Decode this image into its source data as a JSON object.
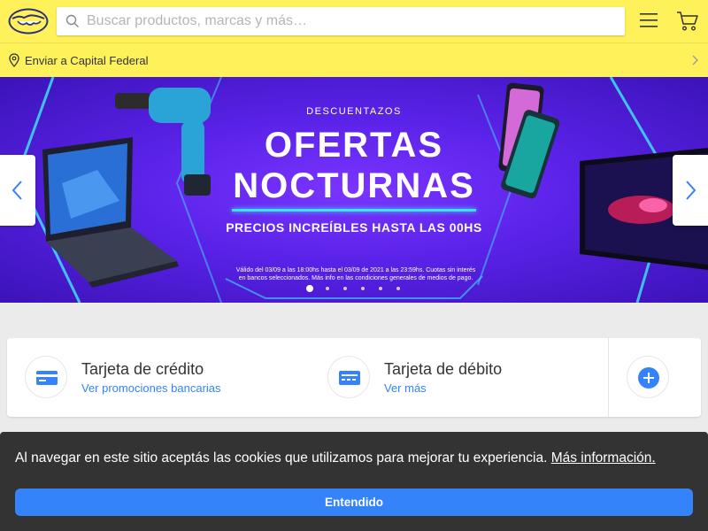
{
  "header": {
    "logo_name": "mercadolibre-handshake-logo",
    "search": {
      "placeholder": "Buscar productos, marcas y más…",
      "value": ""
    },
    "menu_icon": "hamburger-icon",
    "cart_icon": "cart-icon"
  },
  "shipping": {
    "label": "Enviar a Capital Federal",
    "icon": "location-pin-icon"
  },
  "banner": {
    "kicker": "DESCUENTAZOS",
    "title_line1": "OFERTAS",
    "title_line2": "NOCTURNAS",
    "subtitle": "PRECIOS INCREÍBLES HASTA LAS 00HS",
    "legal": "Válido del 03/09 a las 18:00hs hasta el 03/09 de 2021 a las 23:59hs. Cuotas sin interés en bancos seleccionados. Más info en las condiciones generales de medios de pago.",
    "slide_count": 6,
    "active_slide": 1,
    "colors": {
      "background": "#5a22e8",
      "neon": "#3de0ff"
    }
  },
  "payments": [
    {
      "title": "Tarjeta de crédito",
      "link": "Ver promociones bancarias",
      "icon": "credit-card-icon"
    },
    {
      "title": "Tarjeta de débito",
      "link": "Ver más",
      "icon": "debit-card-icon"
    }
  ],
  "more_icon": "plus-icon",
  "cookie": {
    "text": "Al navegar en este sitio aceptás las cookies que utilizamos para mejorar tu experiencia.",
    "link": "Más información.",
    "button": "Entendido"
  },
  "colors": {
    "header": "#fff159",
    "accent": "#3483fa",
    "cookie_bg": "#333333",
    "page_bg": "#ebebeb"
  }
}
